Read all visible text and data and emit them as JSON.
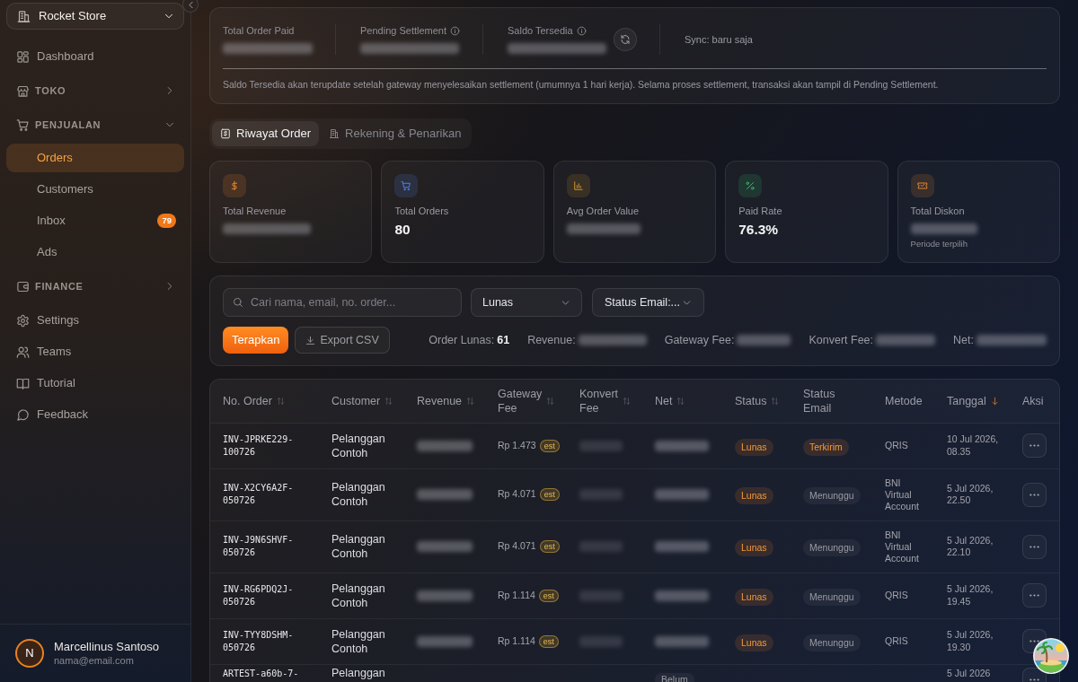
{
  "sidebar": {
    "store": "Rocket Store",
    "items": [
      {
        "label": "Dashboard",
        "kind": "link",
        "selected": false
      },
      {
        "label": "TOKO",
        "kind": "section",
        "expanded": false
      },
      {
        "label": "PENJUALAN",
        "kind": "section",
        "expanded": true,
        "children": [
          {
            "label": "Orders",
            "selected": true
          },
          {
            "label": "Customers",
            "selected": false
          },
          {
            "label": "Inbox",
            "selected": false,
            "badge": "79"
          },
          {
            "label": "Ads",
            "selected": false
          }
        ]
      },
      {
        "label": "FINANCE",
        "kind": "section",
        "expanded": false
      },
      {
        "label": "Settings",
        "kind": "link",
        "selected": false
      },
      {
        "label": "Teams",
        "kind": "link",
        "selected": false
      },
      {
        "label": "Tutorial",
        "kind": "link",
        "selected": false
      },
      {
        "label": "Feedback",
        "kind": "link",
        "selected": false
      }
    ],
    "user": {
      "initial": "N",
      "name": "Marcellinus Santoso",
      "email": "nama@email.com"
    }
  },
  "balance": {
    "items": [
      {
        "label": "Total Order Paid",
        "info": false,
        "blurred": true
      },
      {
        "label": "Pending Settlement",
        "info": true,
        "blurred": true
      },
      {
        "label": "Saldo Tersedia",
        "info": true,
        "blurred": true,
        "refresh": true
      }
    ],
    "sync": "Sync: baru saja",
    "note": "Saldo Tersedia akan terupdate setelah gateway menyelesaikan settlement (umumnya 1 hari kerja). Selama proses settlement, transaksi akan tampil di Pending Settlement."
  },
  "tabs": [
    {
      "label": "Riwayat Order",
      "selected": true
    },
    {
      "label": "Rekening & Penarikan",
      "selected": false
    }
  ],
  "stats": [
    {
      "label": "Total Revenue",
      "blurred": true
    },
    {
      "label": "Total Orders",
      "blurred": false,
      "value": "80"
    },
    {
      "label": "Avg Order Value",
      "blurred": true
    },
    {
      "label": "Paid Rate",
      "blurred": false,
      "value": "76.3%"
    },
    {
      "label": "Total Diskon",
      "blurred": true,
      "note": "Periode terpilih"
    }
  ],
  "filters": {
    "search": {
      "placeholder": "Cari nama, email, no. order..."
    },
    "status": {
      "value": "Lunas"
    },
    "email_status": {
      "value": "Status Email:..."
    },
    "buttons": [
      {
        "label": "Terapkan",
        "kind": "primary"
      },
      {
        "label": "Export CSV",
        "kind": "export"
      }
    ],
    "summary": [
      {
        "label": "Order Lunas:",
        "blurred": false,
        "value": "61"
      },
      {
        "label": "Revenue:",
        "blurred": true
      },
      {
        "label": "Gateway Fee:",
        "blurred": true
      },
      {
        "label": "Konvert Fee:",
        "blurred": true
      },
      {
        "label": "Net:",
        "blurred": true
      }
    ]
  },
  "table": {
    "columns": [
      {
        "label": "No. Order",
        "sortable": true,
        "sorted": false
      },
      {
        "label": "Customer",
        "sortable": true,
        "sorted": false
      },
      {
        "label": "Revenue",
        "sortable": true,
        "sorted": false
      },
      {
        "label": "Gateway Fee",
        "sortable": true,
        "sorted": false
      },
      {
        "label": "Konvert Fee",
        "sortable": true,
        "sorted": false
      },
      {
        "label": "Net",
        "sortable": true,
        "sorted": false
      },
      {
        "label": "Status",
        "sortable": true,
        "sorted": false
      },
      {
        "label": "Status Email",
        "sortable": false
      },
      {
        "label": "Metode",
        "sortable": false
      },
      {
        "label": "Tanggal",
        "sortable": true,
        "sorted": true
      },
      {
        "label": "Aksi",
        "sortable": false
      }
    ],
    "rows": [
      {
        "order": "INV-JPRKE229-100726",
        "customer": "Pelanggan Contoh",
        "amounts_blurred": true,
        "gateway_fee": "Rp 1.473",
        "fee_badge": "est",
        "status": {
          "text": "Lunas",
          "kind": "paid"
        },
        "email_status": {
          "text": "Terkirim",
          "kind": "sent"
        },
        "method": "QRIS",
        "date": "10 Jul 2026, 08.35"
      },
      {
        "order": "INV-X2CY6A2F-050726",
        "customer": "Pelanggan Contoh",
        "amounts_blurred": true,
        "gateway_fee": "Rp 4.071",
        "fee_badge": "est",
        "status": {
          "text": "Lunas",
          "kind": "paid"
        },
        "email_status": {
          "text": "Menunggu",
          "kind": "waiting"
        },
        "method": "BNI Virtual Account",
        "date": "5 Jul 2026, 22.50"
      },
      {
        "order": "INV-J9N6SHVF-050726",
        "customer": "Pelanggan Contoh",
        "amounts_blurred": true,
        "gateway_fee": "Rp 4.071",
        "fee_badge": "est",
        "status": {
          "text": "Lunas",
          "kind": "paid"
        },
        "email_status": {
          "text": "Menunggu",
          "kind": "waiting"
        },
        "method": "BNI Virtual Account",
        "date": "5 Jul 2026, 22.10"
      },
      {
        "order": "INV-RG6PDQ2J-050726",
        "customer": "Pelanggan Contoh",
        "amounts_blurred": true,
        "gateway_fee": "Rp 1.114",
        "fee_badge": "est",
        "status": {
          "text": "Lunas",
          "kind": "paid"
        },
        "email_status": {
          "text": "Menunggu",
          "kind": "waiting"
        },
        "method": "QRIS",
        "date": "5 Jul 2026, 19.45"
      },
      {
        "order": "INV-TYY8DSHM-050726",
        "customer": "Pelanggan Contoh",
        "amounts_blurred": true,
        "gateway_fee": "Rp 1.114",
        "fee_badge": "est",
        "status": {
          "text": "Lunas",
          "kind": "paid"
        },
        "email_status": {
          "text": "Menunggu",
          "kind": "waiting"
        },
        "method": "QRIS",
        "date": "5 Jul 2026, 19.30"
      },
      {
        "order": "ARTEST-a60b-7-",
        "customer": "Pelanggan",
        "amounts_blurred": false,
        "net_note": "Belum",
        "date": "5 Jul 2026"
      }
    ]
  }
}
